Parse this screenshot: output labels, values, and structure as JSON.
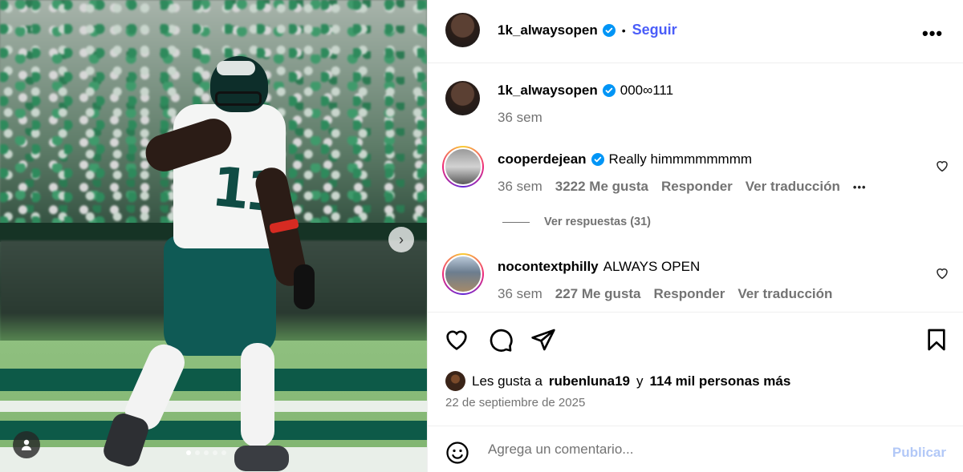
{
  "post": {
    "author": "1k_alwaysopen",
    "follow_label": "Seguir",
    "separator": "•",
    "more_label": "•••",
    "media": {
      "slide_count": 5,
      "active_slide": 1
    },
    "caption": {
      "author": "1k_alwaysopen",
      "text": "000∞111",
      "time": "36 sem"
    },
    "comments": [
      {
        "author": "cooperdejean",
        "verified": true,
        "text": "Really himmmmmmmm",
        "time": "36 sem",
        "likes": "3222 Me gusta",
        "reply": "Responder",
        "translate": "Ver traducción",
        "more": "•••",
        "view_replies": "Ver respuestas (31)"
      },
      {
        "author": "nocontextphilly",
        "verified": false,
        "text": "ALWAYS OPEN",
        "time": "36 sem",
        "likes": "227 Me gusta",
        "reply": "Responder",
        "translate": "Ver traducción"
      }
    ],
    "likes": {
      "prefix": "Les gusta a",
      "user": "rubenluna19",
      "conj": "y",
      "others": "114 mil personas más"
    },
    "date": "22 de septiembre de 2025",
    "comment_box": {
      "placeholder": "Agrega un comentario...",
      "publish": "Publicar"
    }
  },
  "colors": {
    "accent": "#4a5df9",
    "verified": "#0095f6",
    "meta": "#737373",
    "publish_disabled": "#b2c8f7"
  },
  "icons": [
    "verified-icon",
    "heart-icon",
    "comment-icon",
    "share-icon",
    "bookmark-icon",
    "emoji-icon",
    "chevron-right-icon",
    "user-tag-icon",
    "more-icon"
  ]
}
